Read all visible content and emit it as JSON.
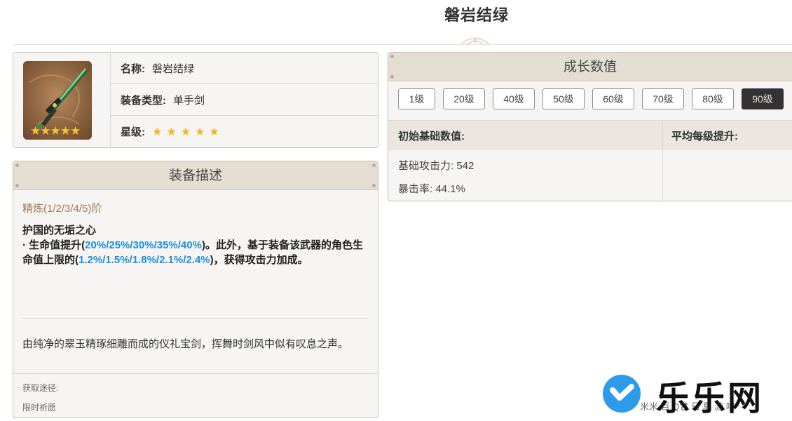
{
  "page": {
    "title": "磐岩结绿"
  },
  "info": {
    "name_key": "名称:",
    "name_value": "磐岩结绿",
    "type_key": "装备类型:",
    "type_value": "单手剑",
    "rarity_key": "星级:",
    "rarity_stars": 5,
    "star_glyph": "★"
  },
  "description": {
    "header": "装备描述",
    "refinement": "精炼(1/2/3/4/5)阶",
    "effect_title": "护国的无垢之心",
    "effect_p1": "· 生命值提升(",
    "effect_v1": "20%/25%/30%/35%/40%",
    "effect_p2": ")。此外，基于装备该武器的角色生命值上限的(",
    "effect_v2": "1.2%/1.5%/1.8%/2.1%/2.4%",
    "effect_p3": ")，获得攻击力加成。",
    "lore": "由纯净的翠玉精琢细雕而成的仪礼宝剑，挥舞时剑风中似有叹息之声。",
    "source_label": "获取途径:",
    "source_value": "限时祈愿"
  },
  "growth": {
    "header": "成长数值",
    "levels": [
      "1级",
      "20级",
      "40级",
      "50级",
      "60级",
      "70级",
      "80级",
      "90级"
    ],
    "active_level": "90级",
    "col_base": "初始基础数值:",
    "col_avg": "平均每级提升:",
    "stat_atk": "基础攻击力: 542",
    "stat_crit": "暴击率: 44.1%"
  },
  "watermark": {
    "brand": "乐乐网",
    "subtext": "米米 百 Q甘 日 夏 游 鸣"
  },
  "colors": {
    "highlight": "#1f8ed8",
    "panel_header": "#e3ddd2",
    "active_button": "#333333",
    "star": "#f2b51f",
    "brand_badge": "#2e9bea"
  }
}
